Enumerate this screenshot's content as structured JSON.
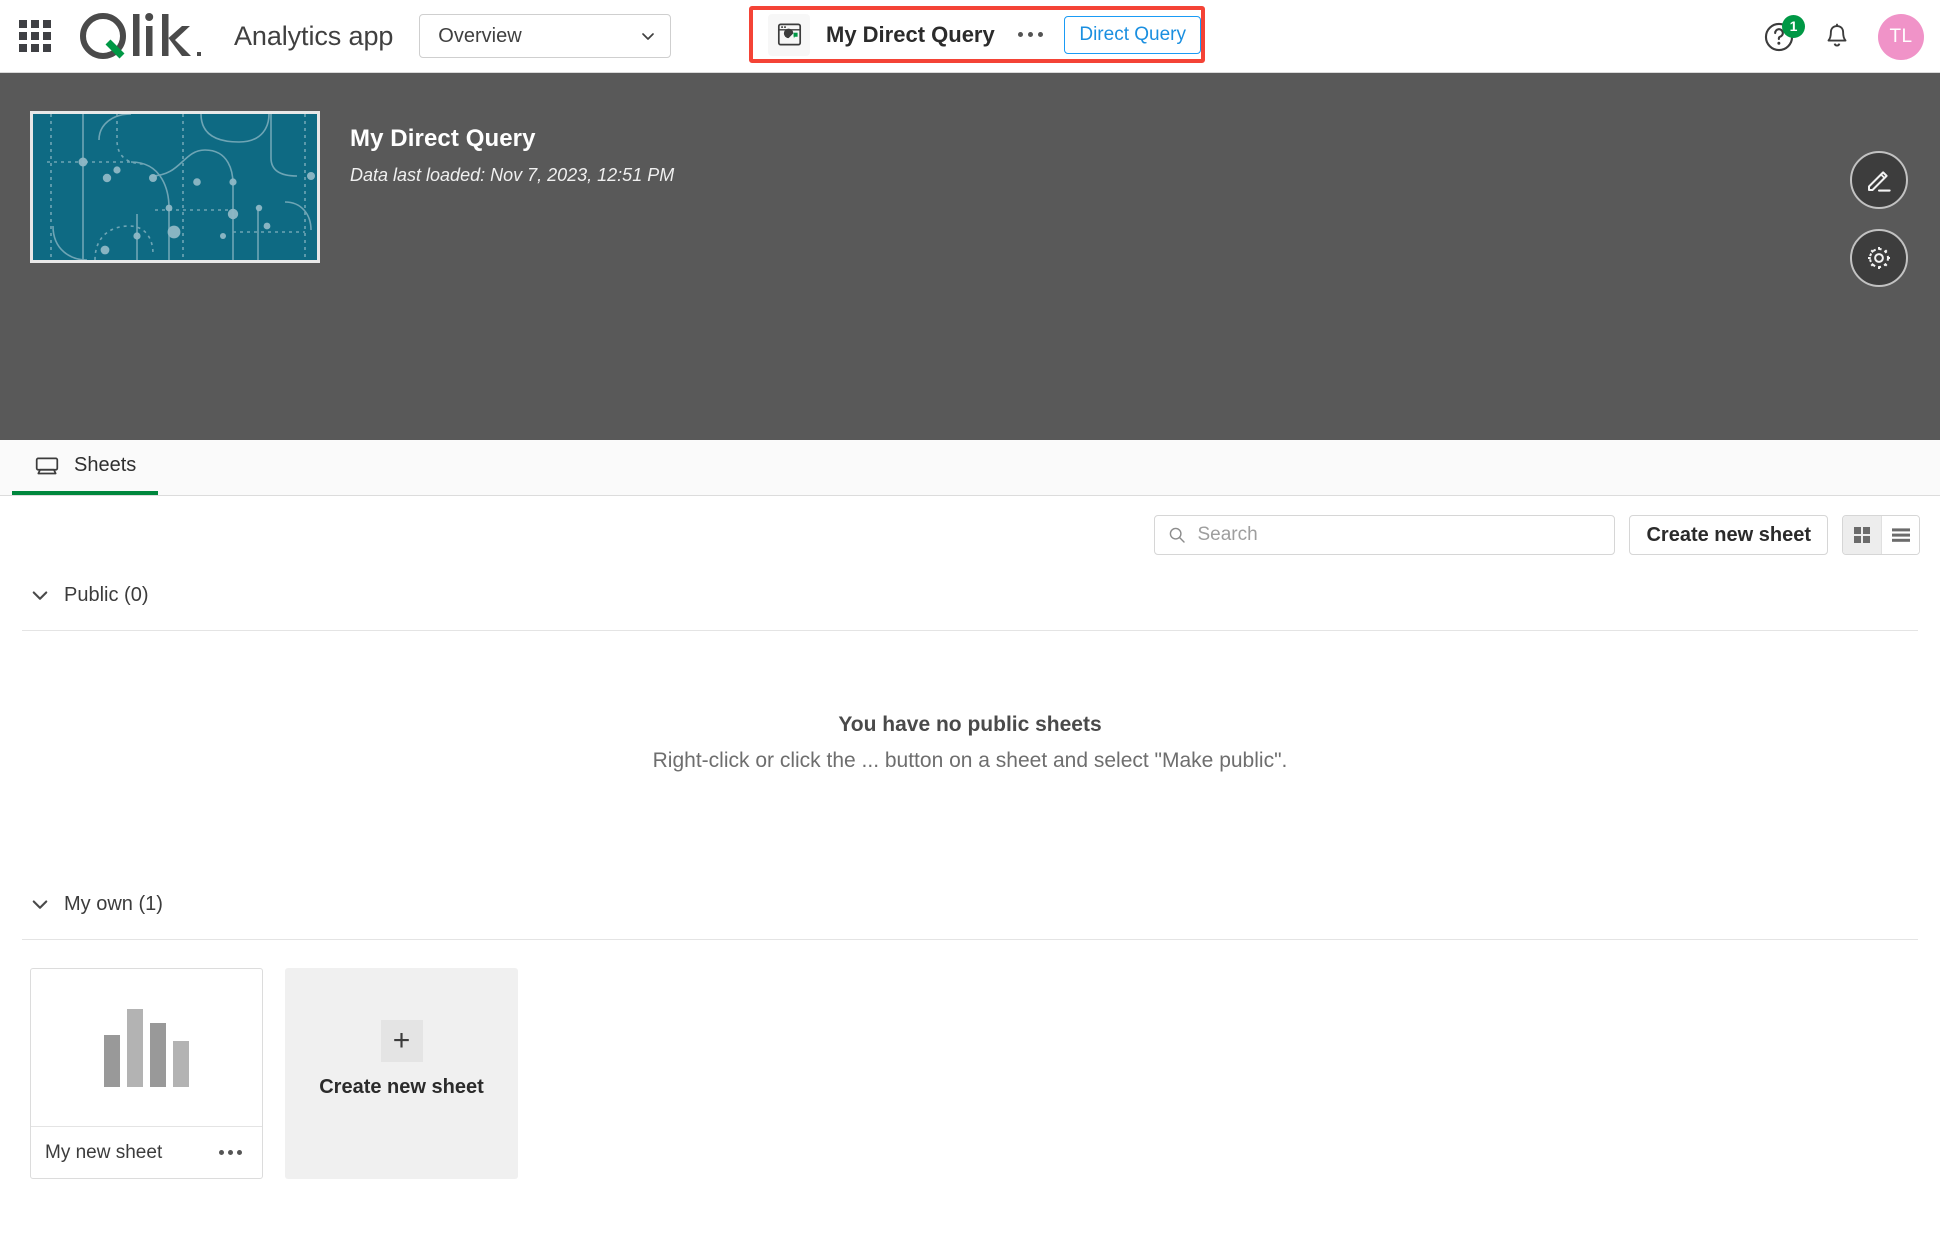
{
  "topbar": {
    "waffle_icon": "app-launcher-grid-icon",
    "logo_text": "Qlik",
    "app_type_label": "Analytics app",
    "space_selector": {
      "value": "Overview",
      "chevron_icon": "chevron-down-icon"
    },
    "app_chip": {
      "icon": "app-window-pie-chart-icon",
      "name": "My Direct Query",
      "more_icon": "ellipsis-icon",
      "badge_label": "Direct Query",
      "highlight_color": "#f44336"
    },
    "right": {
      "help_icon": "help-circle-icon",
      "help_badge_count": "1",
      "help_badge_color": "#009845",
      "notifications_icon": "bell-icon",
      "avatar_initials": "TL",
      "avatar_color": "#f093c8"
    }
  },
  "app_header": {
    "thumbnail_name": "app-thumbnail",
    "thumbnail_color": "#0e6a83",
    "title": "My Direct Query",
    "subtitle": "Data last loaded: Nov 7, 2023, 12:51 PM",
    "background_color": "#595959",
    "actions": [
      {
        "name": "edit-sheet-button",
        "icon": "pencil-icon"
      },
      {
        "name": "app-settings-button",
        "icon": "gear-icon"
      }
    ]
  },
  "tabs": [
    {
      "label": "Sheets",
      "icon": "sheet-icon",
      "active": true
    }
  ],
  "toolbar": {
    "search": {
      "placeholder": "Search",
      "value": "",
      "icon": "search-icon"
    },
    "create_new_sheet_label": "Create new sheet",
    "view_modes": [
      {
        "name": "grid-view-button",
        "icon": "grid-icon",
        "active": true
      },
      {
        "name": "list-view-button",
        "icon": "list-icon",
        "active": false
      }
    ]
  },
  "sections": {
    "public": {
      "label": "Public (0)",
      "collapse_icon": "chevron-down-icon",
      "empty_title": "You have no public sheets",
      "empty_subtitle": "Right-click or click the ... button on a sheet and select \"Make public\"."
    },
    "my_own": {
      "label": "My own (1)",
      "collapse_icon": "chevron-down-icon",
      "sheets": [
        {
          "name": "My new sheet",
          "more_icon": "ellipsis-icon",
          "preview_bars": [
            52,
            78,
            64,
            46
          ],
          "preview_bar_colors": [
            "#999999",
            "#b3b3b3",
            "#999999",
            "#b3b3b3"
          ]
        }
      ],
      "create_card": {
        "plus_icon": "plus-icon",
        "label": "Create new sheet"
      }
    }
  }
}
